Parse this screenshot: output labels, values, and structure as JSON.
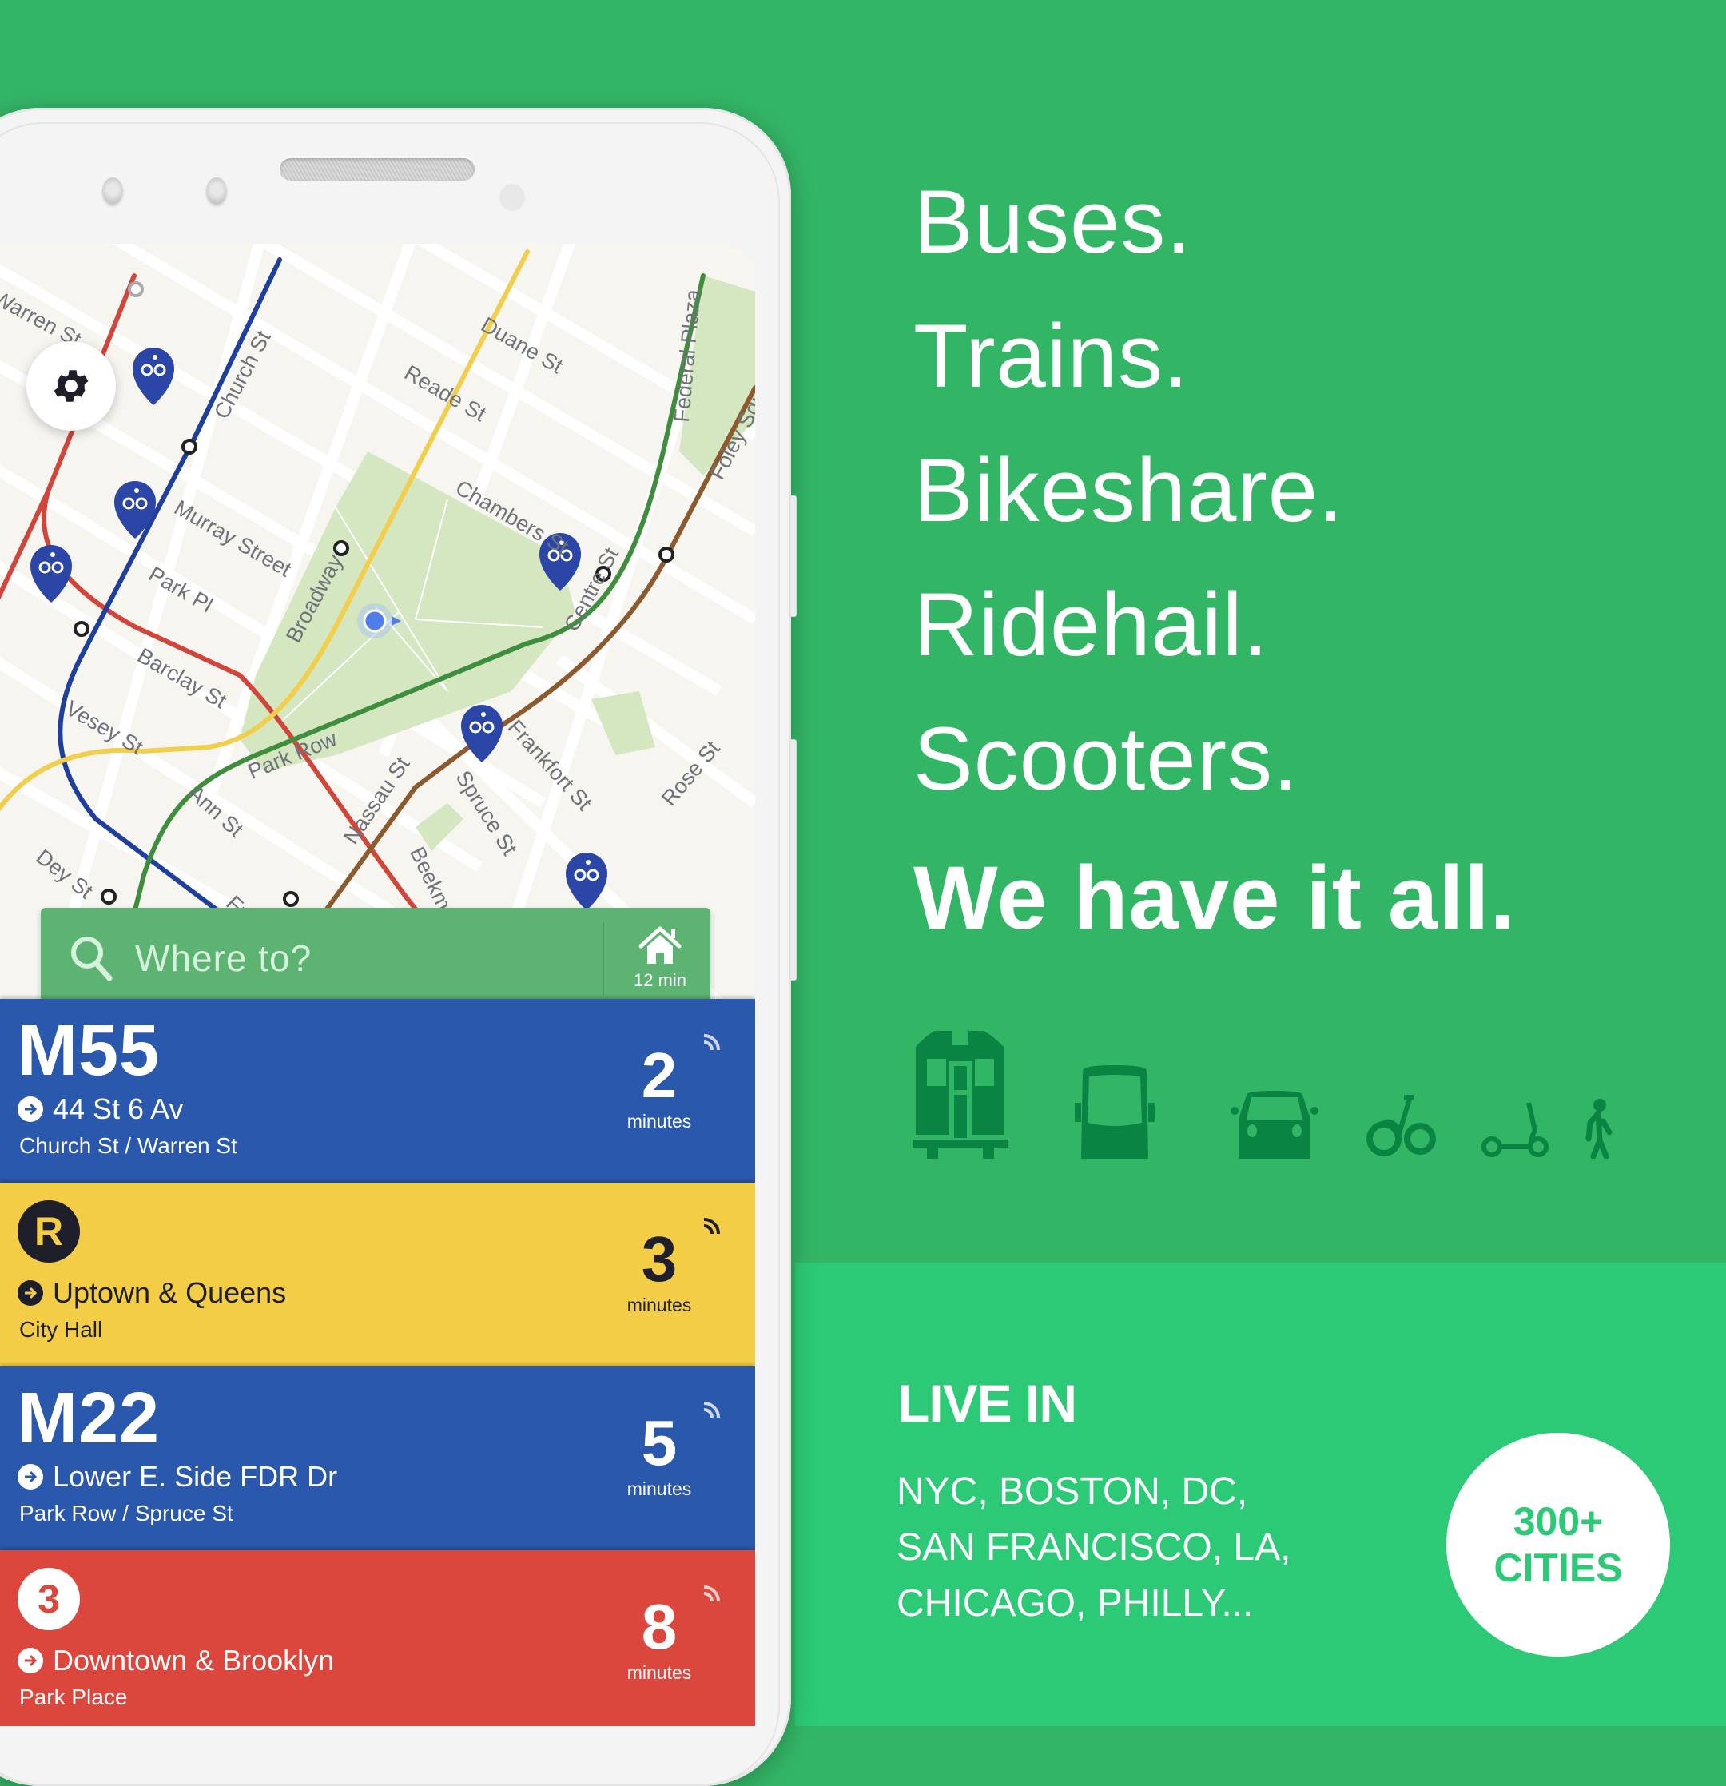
{
  "colors": {
    "background_top": "#33b566",
    "background_bottom": "#2cc976",
    "bus_blue": "#2a58ac",
    "train_yellow": "#f3cd46",
    "train_red": "#db473c",
    "search_green": "#5db371",
    "icon_dark_green": "#0a8443"
  },
  "app": {
    "settings_icon": "gear-icon",
    "search": {
      "placeholder": "Where to?",
      "icon": "search-icon"
    },
    "home_shortcut": {
      "icon": "home-icon",
      "label": "12 min"
    },
    "map": {
      "streets": [
        "Warren St",
        "Church St",
        "Duane St",
        "Reade St",
        "Federal Plaza",
        "Foley Squ",
        "Chambers St",
        "Murray Street",
        "Park Pl",
        "Broadway",
        "Centre St",
        "Barclay St",
        "Vesey St",
        "Park Row",
        "Ann St",
        "Nassau St",
        "Spruce St",
        "Frankfort St",
        "Rose St",
        "Dey St",
        "Beekman",
        "Ful"
      ]
    },
    "departures": [
      {
        "type": "bus",
        "route": "M55",
        "destination": "44 St 6 Av",
        "stop": "Church St / Warren St",
        "minutes": "2",
        "unit": "minutes",
        "color": "#2a58ac",
        "text_color": "#ffffff"
      },
      {
        "type": "train",
        "route": "R",
        "destination": "Uptown & Queens",
        "stop": "City Hall",
        "minutes": "3",
        "unit": "minutes",
        "color": "#f3cd46",
        "text_color": "#1f1f2b"
      },
      {
        "type": "bus",
        "route": "M22",
        "destination": "Lower E. Side FDR Dr",
        "stop": "Park Row / Spruce St",
        "minutes": "5",
        "unit": "minutes",
        "color": "#2a58ac",
        "text_color": "#ffffff"
      },
      {
        "type": "train",
        "route": "3",
        "destination": "Downtown & Brooklyn",
        "stop": "Park Place",
        "minutes": "8",
        "unit": "minutes",
        "color": "#db473c",
        "text_color": "#ffffff"
      }
    ]
  },
  "marketing": {
    "headlines": [
      "Buses.",
      "Trains.",
      "Bikeshare.",
      "Ridehail.",
      "Scooters."
    ],
    "tagline": "We have it all.",
    "mode_icons": [
      "train-icon",
      "bus-icon",
      "car-icon",
      "bikeshare-icon",
      "scooter-icon",
      "walking-icon"
    ],
    "live_in_title": "LIVE IN",
    "cities_lines": [
      "NYC, BOSTON, DC,",
      "SAN FRANCISCO, LA,",
      "CHICAGO, PHILLY..."
    ],
    "count_badge": {
      "line1": "300+",
      "line2": "CITIES"
    }
  }
}
